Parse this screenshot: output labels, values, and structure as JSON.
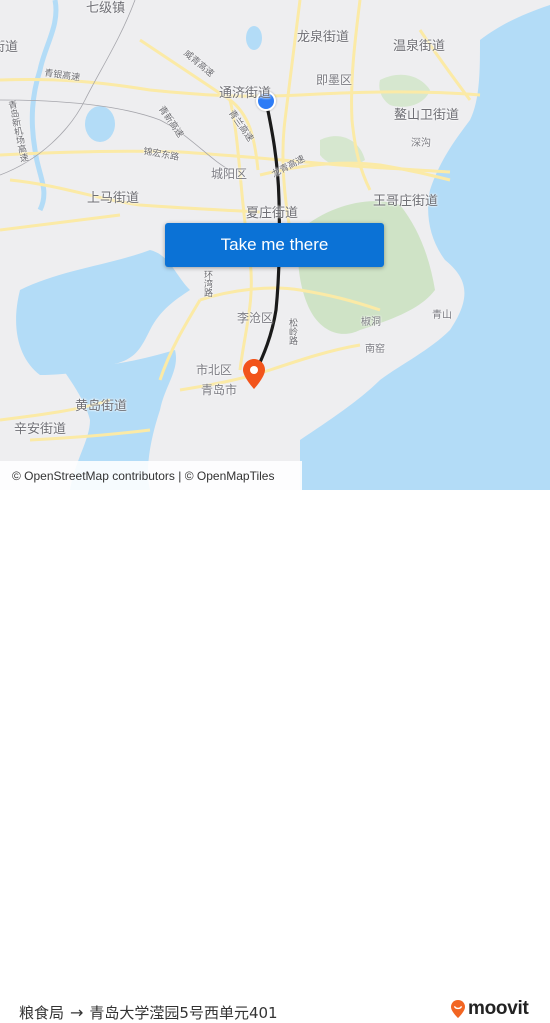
{
  "map": {
    "labels": {
      "qiji": "七级镇",
      "jiedao_tl": "街道",
      "longquan": "龙泉街道",
      "wenquan": "温泉街道",
      "jimo": "即墨区",
      "tongji": "通济街道",
      "aoshanwei": "鳌山卫街道",
      "shengou": "深沟",
      "chengyang": "城阳区",
      "shangma": "上马街道",
      "xiazhuang": "夏庄街道",
      "wanggezhuang": "王哥庄街道",
      "licang": "李沧区",
      "shibei": "市北区",
      "qingdao": "青岛市",
      "huangdao": "黄岛街道",
      "xinan": "辛安街道",
      "jiaodong": "椒洞",
      "nanyao": "南窑",
      "qingshan": "青山",
      "songling": "松岭路",
      "huanwan": "环湾路"
    },
    "roads": {
      "qingyin": "青银高速",
      "qingdao_airport": "青岛新机场高速",
      "weiqing": "威青高速",
      "jinhong": "锦宏东路",
      "qingxin": "青新高速",
      "qinglan": "青兰高速",
      "longqing": "龙青高速"
    },
    "origin_marker": "origin-dot",
    "destination_marker": "destination-pin"
  },
  "cta": {
    "label": "Take me there",
    "color": "#0b72d6"
  },
  "attribution": "© OpenStreetMap contributors | © OpenMapTiles",
  "footer": {
    "origin": "粮食局",
    "arrow": "→",
    "destination": "青岛大学滢园5号西单元401",
    "brand": "moovit",
    "brand_color": "#f26522"
  }
}
